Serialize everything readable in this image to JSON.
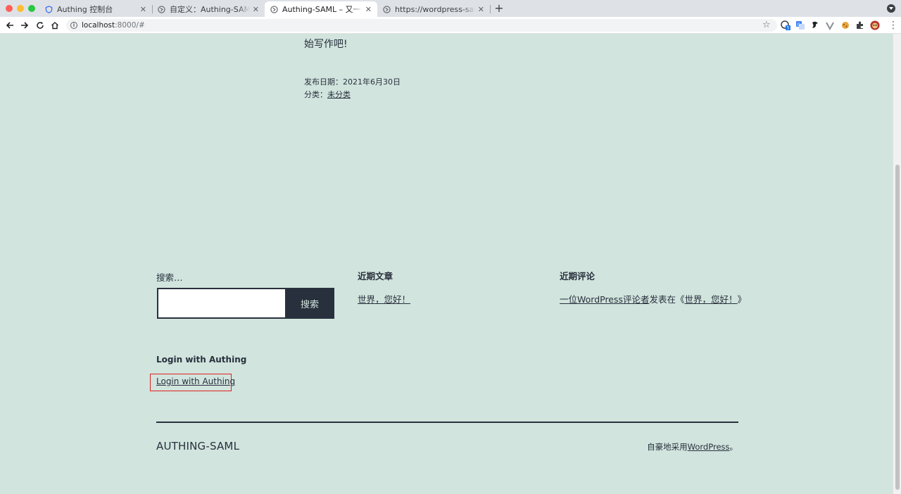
{
  "browser": {
    "tabs": [
      {
        "title": "Authing 控制台",
        "favicon": "shield-icon",
        "active": false
      },
      {
        "title": "自定义：Authing-SAML – ",
        "favicon": "globe-icon",
        "active": false
      },
      {
        "title": "Authing-SAML – 又一个W",
        "favicon": "globe-icon",
        "active": true
      },
      {
        "title": "https://wordpress-saml.a",
        "favicon": "globe-icon",
        "active": false
      }
    ],
    "new_tab_label": "+",
    "address": {
      "host": "localhost",
      "path": ":8000/#"
    },
    "extensions": [
      "extension-badge-icon",
      "translate-icon",
      "vpn-icon",
      "v-icon",
      "cookie-icon",
      "puzzle-icon",
      "profile-avatar-icon"
    ]
  },
  "post": {
    "tail_text": "始写作吧!",
    "published_label": "发布日期：",
    "published_date": "2021年6月30日",
    "category_label": "分类：",
    "category": "未分类"
  },
  "widgets": {
    "search": {
      "label": "搜索…",
      "value": "",
      "button": "搜索"
    },
    "recent_posts": {
      "heading": "近期文章",
      "items": [
        "世界，您好！"
      ]
    },
    "recent_comments": {
      "heading": "近期评论",
      "author": "一位WordPress评论者",
      "connector": "发表在《",
      "post": "世界，您好！",
      "closer": "》"
    },
    "login": {
      "heading": "Login with Authing",
      "link": "Login with Authing"
    }
  },
  "footer": {
    "site_title": "AUTHING-SAML",
    "powered_prefix": "自豪地采用",
    "powered_link": "WordPress",
    "powered_suffix": "。"
  },
  "colors": {
    "background": "#d1e4dd",
    "text": "#28303d",
    "highlight_box": "#e02020"
  }
}
